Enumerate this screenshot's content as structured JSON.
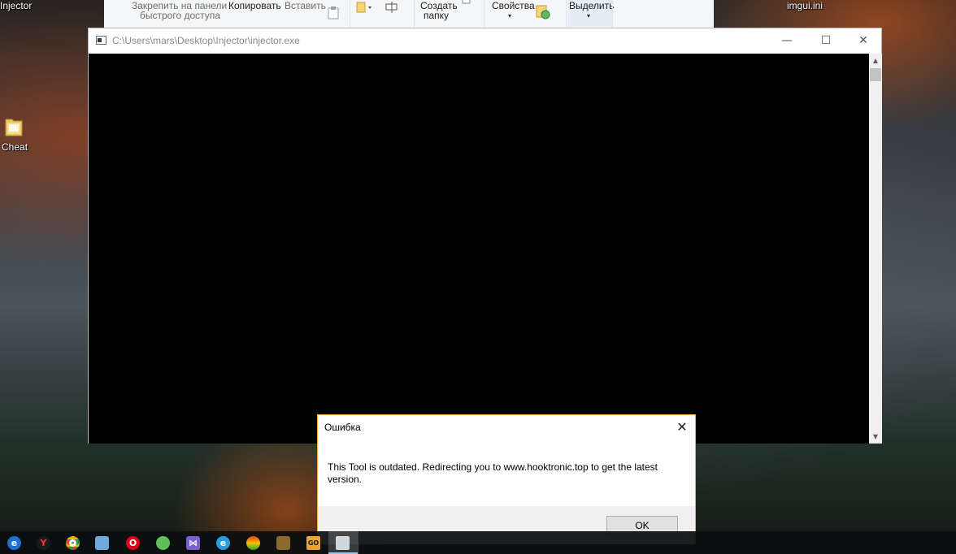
{
  "desktop": {
    "icons": [
      {
        "label": "Injector"
      },
      {
        "label": "imgui.ini"
      },
      {
        "label": "Cheat"
      }
    ]
  },
  "explorer_ribbon": {
    "pin_label_line1": "Закрепить на панели",
    "pin_label_line2": "быстрого доступа",
    "copy_label": "Копировать",
    "paste_label": "Вставить",
    "new_folder_line1": "Создать",
    "new_folder_line2": "папку",
    "properties_label": "Свойства",
    "select_label": "Выделить"
  },
  "console_window": {
    "title": "C:\\Users\\mars\\Desktop\\Injector\\injector.exe",
    "minimize_glyph": "—",
    "maximize_glyph": "☐",
    "close_glyph": "✕"
  },
  "error_dialog": {
    "title": "Ошибка",
    "message": "This Tool is outdated. Redirecting you to www.hooktronic.top to get the latest version.",
    "ok_label": "OK",
    "close_glyph": "✕"
  },
  "taskbar": {
    "items": [
      {
        "icon": "edge-icon",
        "glyph": "e",
        "color": "#1e90ff"
      },
      {
        "icon": "yandex-browser-icon",
        "glyph": "Y",
        "color": "#ffffff"
      },
      {
        "icon": "chrome-icon",
        "glyph": "",
        "color": "#f2b200"
      },
      {
        "icon": "control-panel-icon",
        "glyph": "",
        "color": "#6fa8dc"
      },
      {
        "icon": "opera-icon",
        "glyph": "O",
        "color": "#e0001b"
      },
      {
        "icon": "globe-app-icon",
        "glyph": "",
        "color": "#5cbf5c"
      },
      {
        "icon": "visual-studio-icon",
        "glyph": "⋈",
        "color": "#7b5fcf"
      },
      {
        "icon": "internet-explorer-icon",
        "glyph": "e",
        "color": "#2b9be0"
      },
      {
        "icon": "rainbow-app-icon",
        "glyph": "",
        "color": "#e05a1a"
      },
      {
        "icon": "game-app-icon",
        "glyph": "",
        "color": "#c9a55c"
      },
      {
        "icon": "csgo-icon",
        "glyph": "GO",
        "color": "#e8a33a"
      },
      {
        "icon": "console-app-icon",
        "glyph": "",
        "color": "#cfd8dc"
      }
    ]
  }
}
